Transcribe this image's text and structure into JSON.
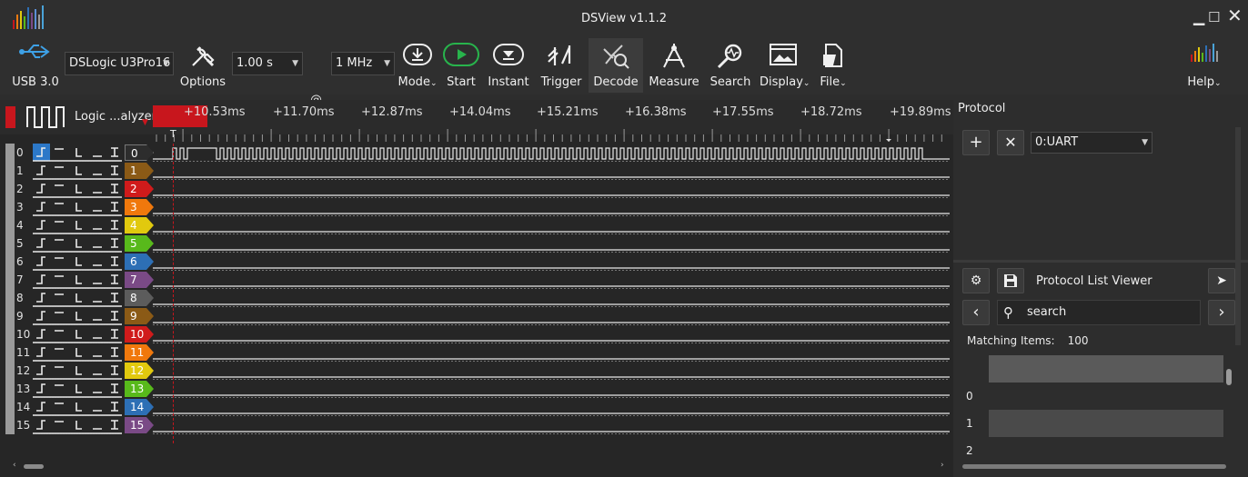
{
  "window": {
    "title": "DSView v1.1.2"
  },
  "toolbar": {
    "usb_label": "USB 3.0",
    "device": "DSLogic U3Pro16",
    "duration": "1.00 s",
    "at_symbol": "@",
    "rate": "1 MHz",
    "options": "Options",
    "mode": "Mode",
    "start": "Start",
    "instant": "Instant",
    "trigger": "Trigger",
    "decode": "Decode",
    "measure": "Measure",
    "search": "Search",
    "display": "Display",
    "file": "File",
    "help": "Help"
  },
  "group": {
    "name": "Logic ...alyzer"
  },
  "ruler": {
    "labels": [
      "+10.53ms",
      "+11.70ms",
      "+12.87ms",
      "+14.04ms",
      "+15.21ms",
      "+16.38ms",
      "+17.55ms",
      "+18.72ms",
      "+19.89ms"
    ],
    "trigger_marker": "T"
  },
  "channels": [
    {
      "num": "0",
      "tag": "0",
      "color": "#2d2d2d"
    },
    {
      "num": "1",
      "tag": "1",
      "color": "#8b5a16"
    },
    {
      "num": "2",
      "tag": "2",
      "color": "#d01b1b"
    },
    {
      "num": "3",
      "tag": "3",
      "color": "#f0780c"
    },
    {
      "num": "4",
      "tag": "4",
      "color": "#e1c90e"
    },
    {
      "num": "5",
      "tag": "5",
      "color": "#58b91b"
    },
    {
      "num": "6",
      "tag": "6",
      "color": "#2d6fb5"
    },
    {
      "num": "7",
      "tag": "7",
      "color": "#7a4a86"
    },
    {
      "num": "8",
      "tag": "8",
      "color": "#5c5c5c"
    },
    {
      "num": "9",
      "tag": "9",
      "color": "#8b5a16"
    },
    {
      "num": "10",
      "tag": "10",
      "color": "#d01b1b"
    },
    {
      "num": "11",
      "tag": "11",
      "color": "#f0780c"
    },
    {
      "num": "12",
      "tag": "12",
      "color": "#e1c90e"
    },
    {
      "num": "13",
      "tag": "13",
      "color": "#58b91b"
    },
    {
      "num": "14",
      "tag": "14",
      "color": "#2d6fb5"
    },
    {
      "num": "15",
      "tag": "15",
      "color": "#7a4a86"
    }
  ],
  "protocol": {
    "label": "Protocol",
    "decoder": "0:UART",
    "list_title": "Protocol List Viewer",
    "search_placeholder": "search",
    "matching_label": "Matching Items:",
    "matching_count": "100",
    "rows": [
      "0",
      "1",
      "2"
    ]
  }
}
